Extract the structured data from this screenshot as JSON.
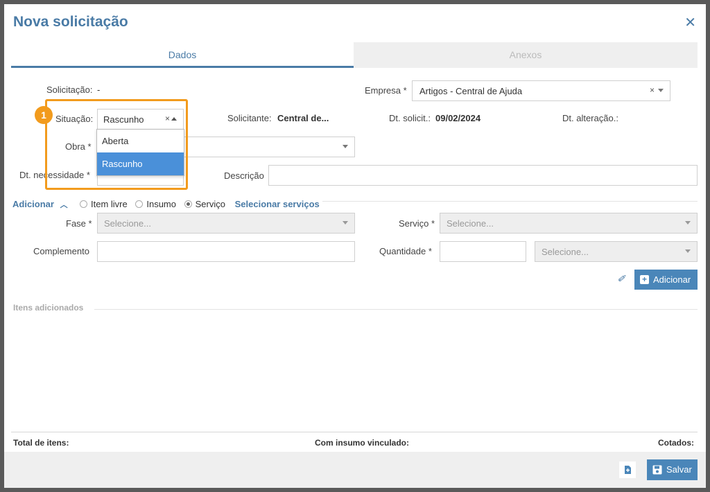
{
  "modal": {
    "title": "Nova solicitação"
  },
  "tabs": [
    {
      "label": "Dados"
    },
    {
      "label": "Anexos"
    }
  ],
  "form": {
    "solicitacao_label": "Solicitação:",
    "solicitacao_value": "-",
    "empresa_label": "Empresa *",
    "empresa_value": "Artigos - Central de Ajuda",
    "situacao_label": "Situação:",
    "situacao_value": "Rascunho",
    "situacao_options": [
      "Aberta",
      "Rascunho"
    ],
    "solicitante_label": "Solicitante:",
    "solicitante_value": "Central de...",
    "dt_solicit_label": "Dt. solicit.:",
    "dt_solicit_value": "09/02/2024",
    "dt_alteracao_label": "Dt. alteração.:",
    "obra_label": "Obra *",
    "dt_necessidade_label": "Dt. necessidade *",
    "descricao_label": "Descrição"
  },
  "annotation": {
    "number": "1",
    "color": "#f29b1d"
  },
  "adicionar": {
    "toggle_label": "Adicionar",
    "radio_options": [
      "Item livre",
      "Insumo",
      "Serviço"
    ],
    "selected_radio": "Serviço",
    "select_link": "Selecionar serviços",
    "fase_label": "Fase *",
    "fase_placeholder": "Selecione...",
    "servico_label": "Serviço *",
    "servico_placeholder": "Selecione...",
    "complemento_label": "Complemento",
    "quantidade_label": "Quantidade *",
    "unidade_placeholder": "Selecione...",
    "add_button": "Adicionar"
  },
  "items": {
    "section_title": "Itens adicionados",
    "total_label": "Total de itens:",
    "insumo_label": "Com insumo vinculado:",
    "cotados_label": "Cotados:"
  },
  "footer": {
    "save_button": "Salvar"
  },
  "colors": {
    "accent": "#4a7ba6",
    "button": "#4a86b9",
    "selected_option": "#4a90d9"
  }
}
